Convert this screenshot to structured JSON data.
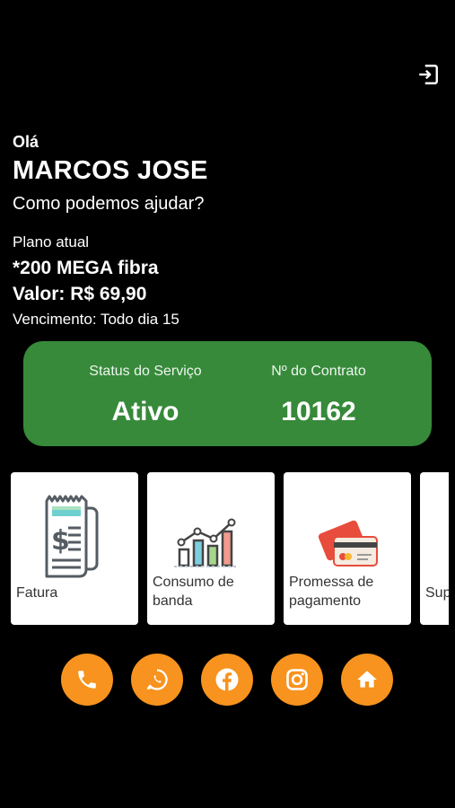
{
  "header": {
    "logout_icon": "logout-icon"
  },
  "greeting": {
    "hello": "Olá",
    "name": "MARCOS JOSE",
    "help": "Como podemos ajudar?"
  },
  "plan": {
    "label": "Plano atual",
    "name": "*200 MEGA fibra",
    "price": "Valor: R$ 69,90",
    "due": "Vencimento: Todo dia 15"
  },
  "status": {
    "service_label": "Status do Serviço",
    "service_value": "Ativo",
    "contract_label": "Nº do Contrato",
    "contract_value": "10162",
    "card_color": "#368a3a"
  },
  "tiles": [
    {
      "label": "Fatura",
      "icon": "invoice-icon"
    },
    {
      "label": "Consumo de banda",
      "icon": "bandwidth-chart-icon"
    },
    {
      "label": "Promessa de pagamento",
      "icon": "credit-card-icon"
    },
    {
      "label": "Sup",
      "icon": "support-icon"
    }
  ],
  "social": {
    "accent": "#f7931e",
    "buttons": [
      "phone-icon",
      "whatsapp-icon",
      "facebook-icon",
      "instagram-icon",
      "home-icon"
    ]
  }
}
